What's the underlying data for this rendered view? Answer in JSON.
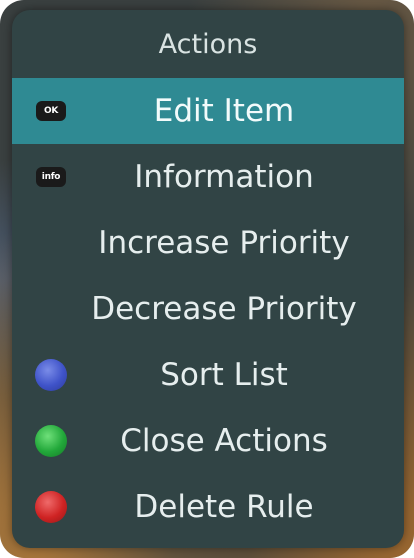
{
  "menu": {
    "title": "Actions",
    "items": [
      {
        "label": "Edit Item",
        "icon": "ok-button-icon",
        "icon_text": "OK",
        "selected": true
      },
      {
        "label": "Information",
        "icon": "info-button-icon",
        "icon_text": "info"
      },
      {
        "label": "Increase Priority"
      },
      {
        "label": "Decrease Priority"
      },
      {
        "label": "Sort List",
        "icon": "blue-button-icon",
        "color": "#3f53c9"
      },
      {
        "label": "Close Actions",
        "icon": "green-button-icon",
        "color": "#22a83a"
      },
      {
        "label": "Delete Rule",
        "icon": "red-button-icon",
        "color": "#cf2323"
      }
    ]
  },
  "colors": {
    "panel": "#314445",
    "selected": "#2f8a93",
    "text": "#e6eeee"
  }
}
